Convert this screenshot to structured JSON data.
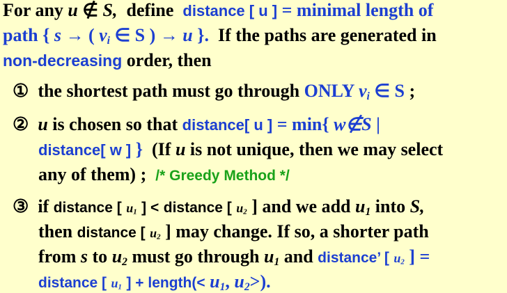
{
  "intro": {
    "for_any": "For any",
    "u": "u",
    "notin": "∉",
    "S": "S,",
    "define": "define",
    "distance_u": "distance [ u ]",
    "eq_min_len": "= minimal length of",
    "path": "path",
    "set_expr_open": "{",
    "s": "s",
    "arrow1": "→ (",
    "vi": "v",
    "i": "i",
    "in_S": "∈ S )",
    "arrow2": "→",
    "u2": "u",
    "set_close": "}.",
    "if_paths": "If the paths are generated in",
    "non_decreasing": "non-decreasing",
    "order_then": "order, then"
  },
  "item1": {
    "marker": "①",
    "text_a": "the shortest path must go through",
    "only": "ONLY",
    "v": "v",
    "i": "i",
    "in_S": "∈ S",
    "semi": ";"
  },
  "item2": {
    "marker": "②",
    "u": "u",
    "chosen": "is chosen so that",
    "distance_u": "distance[ u ]",
    "eq_min": "= min{",
    "w_notin_S": "w∉S",
    "bar": "|",
    "distance_w": "distance[ w ]",
    "close": "}",
    "if_not_unique": "(If",
    "u2": "u",
    "rest": "is not unique, then we may select",
    "any_of_them": "any of them) ;",
    "greedy": "/* Greedy Method */"
  },
  "item3": {
    "marker": "③",
    "if": "if",
    "distance_open": "distance [",
    "u": "u",
    "one": "1",
    "two": "2",
    "close_lt": "] <",
    "distance_open2": "distance [",
    "close_and": "] and we add",
    "into": "into",
    "S": "S,",
    "then": "then",
    "distance_open3": "distance [",
    "may_change": "] may change.  If so, a shorter path",
    "from": "from",
    "s": "s",
    "to": "to",
    "must_go": "must go through",
    "and": "and",
    "distance_prime": "distance’ [",
    "close_eq": "] =",
    "distance_open4": "distance [",
    "plus_length": "] + length(<",
    "comma": ",",
    "end": ">)."
  }
}
